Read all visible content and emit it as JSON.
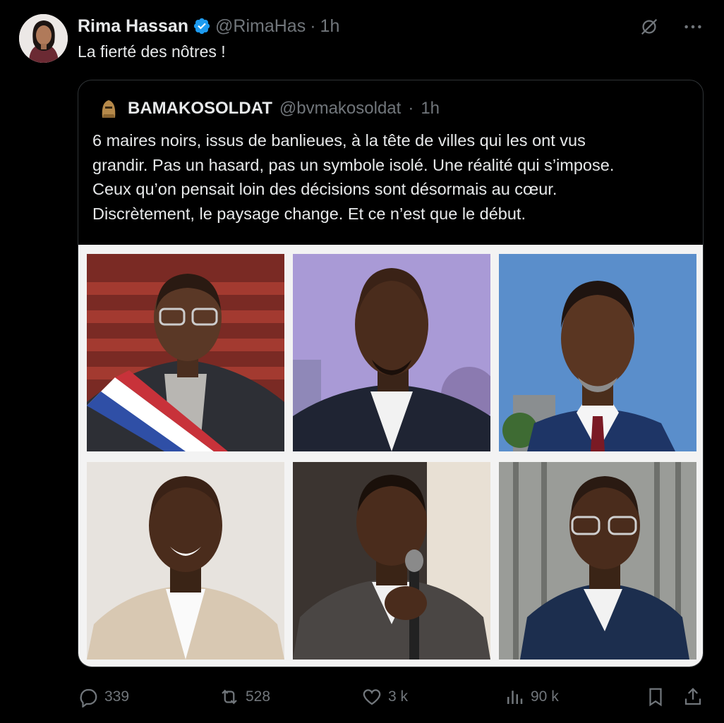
{
  "tweet": {
    "author_name": "Rima Hassan",
    "author_handle": "@RimaHas",
    "time": "1h",
    "separator": "·",
    "text": "La fierté des nôtres !"
  },
  "quoted": {
    "author_name": "BAMAKOSOLDAT",
    "author_handle": "@bvmakosoldat",
    "time": "1h",
    "separator": "·",
    "text_lines": [
      "6 maires noirs, issus de banlieues, à la tête de villes qui les ont vus",
      "grandir. Pas un hasard, pas un symbole isolé. Une réalité qui s’impose.",
      "Ceux qu’on pensait loin des décisions sont désormais au cœur.",
      "Discrètement, le paysage change. Et ce n’est que le début."
    ]
  },
  "actions": {
    "replies": "339",
    "reposts": "528",
    "likes": "3 k",
    "views": "90 k"
  },
  "icons": {
    "verified": "verified-badge-icon",
    "grok": "grok-icon",
    "more": "more-icon",
    "reply": "reply-icon",
    "repost": "repost-icon",
    "like": "heart-icon",
    "views": "views-icon",
    "bookmark": "bookmark-icon",
    "share": "share-icon"
  },
  "colors": {
    "background": "#000000",
    "text": "#e7e9ea",
    "secondary": "#71767b",
    "verified": "#1d9bf0",
    "border": "#2f3336"
  }
}
